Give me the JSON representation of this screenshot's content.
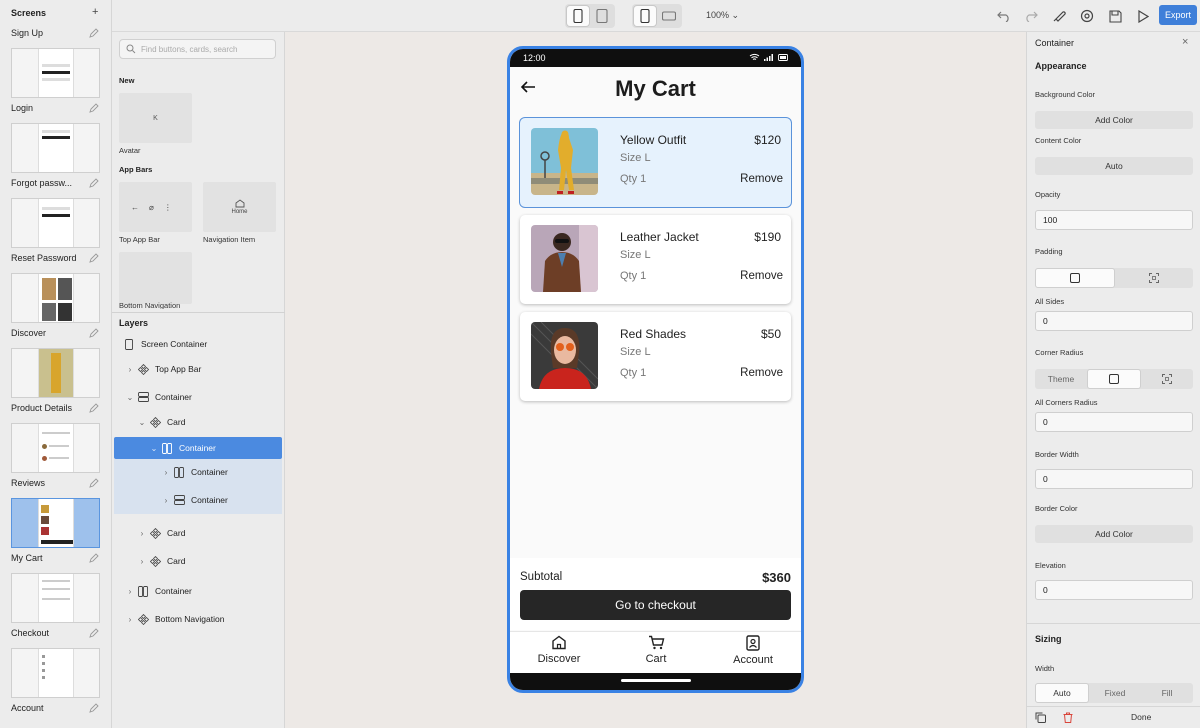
{
  "screens_panel": {
    "title": "Screens",
    "add_icon": "plus-icon",
    "items": [
      {
        "label": "Sign Up"
      },
      {
        "label": "Login"
      },
      {
        "label": "Forgot passw..."
      },
      {
        "label": "Reset Password"
      },
      {
        "label": "Discover"
      },
      {
        "label": "Product Details"
      },
      {
        "label": "Reviews"
      },
      {
        "label": "My Cart",
        "selected": true
      },
      {
        "label": "Checkout"
      },
      {
        "label": "Account"
      }
    ]
  },
  "components_panel": {
    "search_placeholder": "Find buttons, cards, search",
    "sections": [
      {
        "title": "New"
      },
      {
        "title": "App Bars"
      }
    ],
    "avatar_initial": "K",
    "avatar_label": "Avatar",
    "top_app_bar_label": "Top App Bar",
    "nav_item_label": "Navigation Item",
    "nav_item_preview": "Home",
    "bottom_nav_label": "Bottom Navigation"
  },
  "layers": {
    "title": "Layers",
    "items": [
      {
        "label": "Screen Container",
        "icon": "phone-icon"
      },
      {
        "label": "Top App Bar",
        "icon": "component-icon"
      },
      {
        "label": "Container",
        "icon": "rows-icon"
      },
      {
        "label": "Card",
        "icon": "component-icon"
      },
      {
        "label": "Container",
        "icon": "columns-icon",
        "selected": true
      },
      {
        "label": "Container",
        "icon": "columns-icon"
      },
      {
        "label": "Container",
        "icon": "rows-icon"
      },
      {
        "label": "Card",
        "icon": "component-icon"
      },
      {
        "label": "Card",
        "icon": "component-icon"
      },
      {
        "label": "Container",
        "icon": "columns-icon"
      },
      {
        "label": "Bottom Navigation",
        "icon": "component-icon"
      }
    ]
  },
  "toolbar": {
    "zoom": "100%",
    "export_label": "Export"
  },
  "phone": {
    "time": "12:00",
    "title": "My Cart",
    "items": [
      {
        "name": "Yellow Outfit",
        "size": "Size L",
        "qty": "Qty 1",
        "price": "$120",
        "remove": "Remove",
        "image": "yellow-outfit-photo"
      },
      {
        "name": "Leather Jacket",
        "size": "Size L",
        "qty": "Qty 1",
        "price": "$190",
        "remove": "Remove",
        "image": "leather-jacket-photo"
      },
      {
        "name": "Red Shades",
        "size": "Size L",
        "qty": "Qty 1",
        "price": "$50",
        "remove": "Remove",
        "image": "red-shades-photo"
      }
    ],
    "subtotal_label": "Subtotal",
    "subtotal_value": "$360",
    "checkout_label": "Go to checkout",
    "nav": [
      {
        "label": "Discover",
        "icon": "home-icon"
      },
      {
        "label": "Cart",
        "icon": "cart-icon"
      },
      {
        "label": "Account",
        "icon": "account-icon"
      }
    ]
  },
  "properties": {
    "component": "Container",
    "appearance": "Appearance",
    "background_color_label": "Background Color",
    "background_color_btn": "Add Color",
    "content_color_label": "Content Color",
    "content_color_btn": "Auto",
    "opacity_label": "Opacity",
    "opacity_value": "100",
    "padding_label": "Padding",
    "all_sides_label": "All Sides",
    "all_sides_value": "0",
    "corner_radius_label": "Corner Radius",
    "corner_theme": "Theme",
    "all_corners_label": "All Corners Radius",
    "all_corners_value": "0",
    "border_width_label": "Border Width",
    "border_width_value": "0",
    "border_color_label": "Border Color",
    "border_color_btn": "Add Color",
    "elevation_label": "Elevation",
    "elevation_value": "0",
    "sizing": "Sizing",
    "width_label": "Width",
    "width_options": [
      "Auto",
      "Fixed",
      "Fill"
    ],
    "done_label": "Done"
  },
  "colors": {
    "accent": "#3a82e4",
    "selected_layer": "#4b8ae0",
    "delete": "#d9443a"
  }
}
